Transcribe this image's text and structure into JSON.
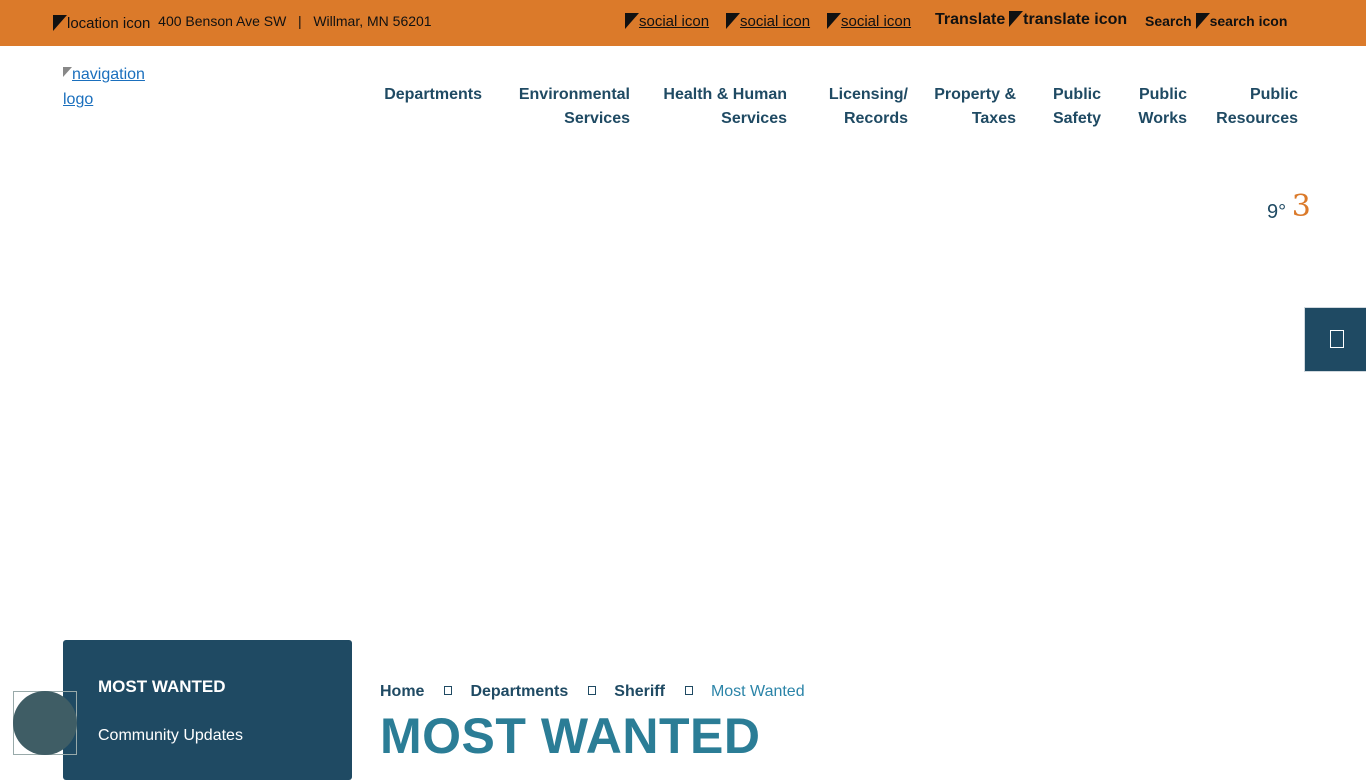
{
  "topbar": {
    "location_icon_alt": "location icon",
    "address_street": "400 Benson Ave SW",
    "separator": "|",
    "address_city": "Willmar, MN 56201",
    "social_icon_alt": "social icon",
    "translate_label": "Translate",
    "translate_icon_alt": "translate icon",
    "search_label": "Search",
    "search_icon_alt": "search icon",
    "bg_color": "#db7a2a"
  },
  "logo": {
    "alt": "navigation logo"
  },
  "nav": {
    "items": [
      {
        "line1": "Departments",
        "line2": ""
      },
      {
        "line1": "Environmental",
        "line2": "Services"
      },
      {
        "line1": "Health & Human",
        "line2": "Services"
      },
      {
        "line1": "Licensing/",
        "line2": "Records"
      },
      {
        "line1": "Property &",
        "line2": "Taxes"
      },
      {
        "line1": "Public",
        "line2": "Safety"
      },
      {
        "line1": "Public",
        "line2": "Works"
      },
      {
        "line1": "Public",
        "line2": "Resources"
      }
    ]
  },
  "weather": {
    "temp": "9°",
    "icon_glyph": "3"
  },
  "side_tab": {
    "icon": "page-icon"
  },
  "sidebar": {
    "title": "MOST WANTED",
    "links": [
      "Community Updates"
    ]
  },
  "breadcrumb": {
    "items": [
      "Home",
      "Departments",
      "Sheriff"
    ],
    "current": "Most Wanted"
  },
  "page": {
    "title": "MOST WANTED"
  },
  "colors": {
    "navy": "#1f4a63",
    "teal": "#2b7d96",
    "orange": "#db7a2a"
  }
}
